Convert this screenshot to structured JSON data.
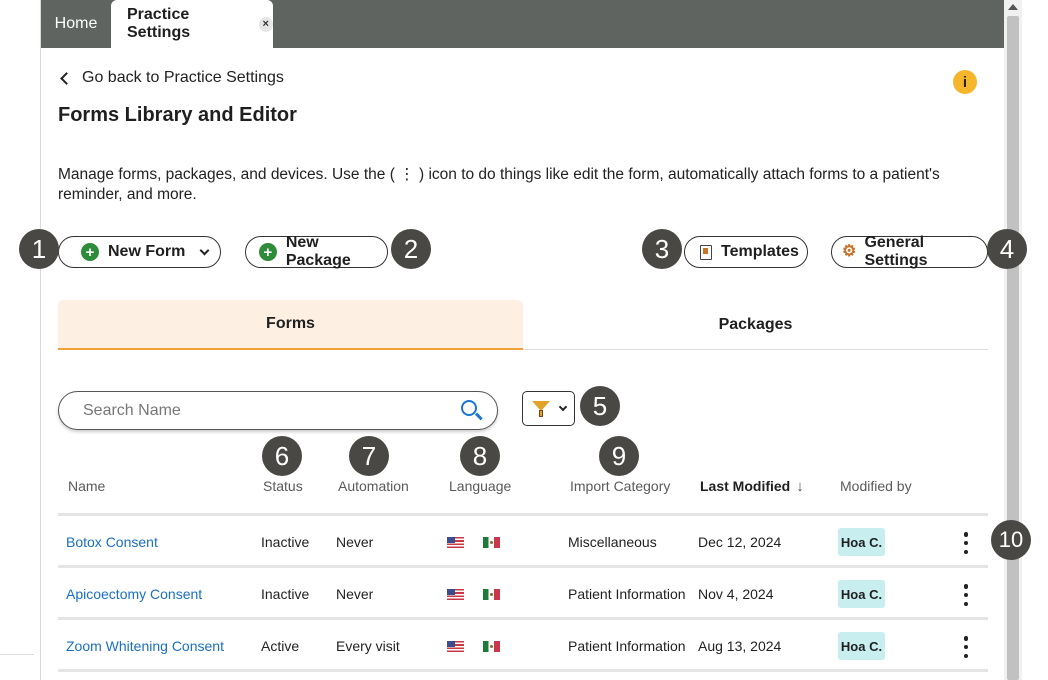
{
  "tabs": {
    "home": "Home",
    "active": "Practice Settings",
    "close_glyph": "×"
  },
  "header": {
    "back_link": "Go back to Practice Settings",
    "title": "Forms Library and Editor",
    "info_glyph": "i",
    "description": "Manage forms, packages, and devices. Use the ( ⋮ ) icon to do things like edit the form, automatically attach forms to a patient's reminder, and more."
  },
  "actions": {
    "new_form": "New Form",
    "new_package": "New Package",
    "templates": "Templates",
    "general_settings": "General Settings"
  },
  "badges": [
    "1",
    "2",
    "3",
    "4",
    "5",
    "6",
    "7",
    "8",
    "9",
    "10"
  ],
  "view_tabs": {
    "forms": "Forms",
    "packages": "Packages"
  },
  "search": {
    "placeholder": "Search Name"
  },
  "table": {
    "columns": [
      "Name",
      "Status",
      "Automation",
      "Language",
      "Import Category",
      "Last Modified",
      "Modified by"
    ],
    "sort_glyph": "↓",
    "rows": [
      {
        "name": "Botox Consent",
        "status": "Inactive",
        "automation": "Never",
        "category": "Miscellaneous",
        "modified": "Dec 12, 2024",
        "by": "Hoa C."
      },
      {
        "name": "Apicoectomy Consent",
        "status": "Inactive",
        "automation": "Never",
        "category": "Patient Information",
        "modified": "Nov 4, 2024",
        "by": "Hoa C."
      },
      {
        "name": "Zoom Whitening Consent",
        "status": "Active",
        "automation": "Every visit",
        "category": "Patient Information",
        "modified": "Aug 13, 2024",
        "by": "Hoa C."
      }
    ]
  },
  "colors": {
    "tabbar": "#5f6461",
    "accent_orange": "#f0a13a",
    "link_blue": "#1a6fc4",
    "plus_green": "#2e8b3a",
    "badge_dark": "#4a4845",
    "chip_teal": "#c8eef0"
  }
}
